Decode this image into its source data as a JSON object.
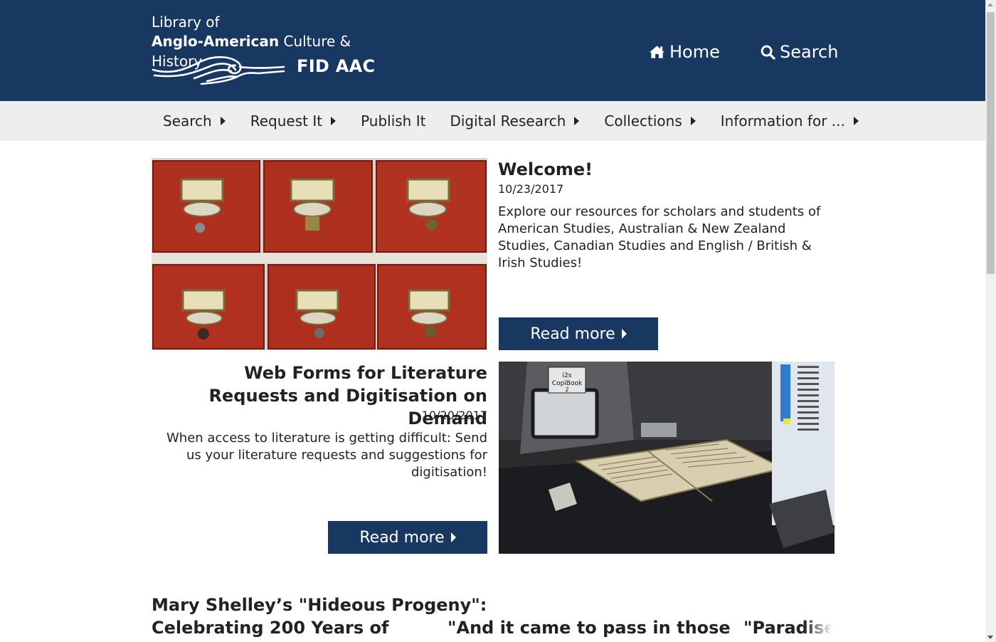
{
  "header": {
    "brand_line1": "Library of",
    "brand_line2_bold": "Anglo-American",
    "brand_line2_rest": " Culture & History",
    "logo_text": "FID AAC",
    "nav": [
      {
        "label": "Home",
        "icon": "home-icon"
      },
      {
        "label": "Search",
        "icon": "search-icon"
      }
    ]
  },
  "menu": {
    "items": [
      {
        "label": "Search",
        "has_submenu": true
      },
      {
        "label": "Request It",
        "has_submenu": true
      },
      {
        "label": "Publish It",
        "has_submenu": false
      },
      {
        "label": "Digital Research",
        "has_submenu": true
      },
      {
        "label": "Collections",
        "has_submenu": true
      },
      {
        "label": "Information for ...",
        "has_submenu": true
      }
    ]
  },
  "articles": [
    {
      "title": "Welcome!",
      "date": "10/23/2017",
      "text": "Explore our resources for scholars and students of American Studies, Australian & New Zealand Studies, Canadian Studies and English / British & Irish Studies!",
      "button": "Read more",
      "image": "card-catalog-drawers-photo"
    },
    {
      "title": "Web Forms for Literature Requests and Digitisation on Demand",
      "date": "10/20/2017",
      "text": "When access to literature is getting difficult: Send us your literature requests and suggestions for digitisation!",
      "button": "Read more",
      "image": "book-scanner-photo"
    }
  ],
  "bottom_articles": [
    {
      "title_line1": "Mary Shelley’s \"Hideous Progeny\":",
      "title_line2": "Celebrating 200 Years of"
    },
    {
      "title_line1": "\"And it came to pass in those"
    },
    {
      "title_line1": "\"Paradise L"
    }
  ],
  "colors": {
    "brand_navy": "#183862",
    "menu_bg": "#eeeeee",
    "drawer_red": "#b0301f"
  }
}
